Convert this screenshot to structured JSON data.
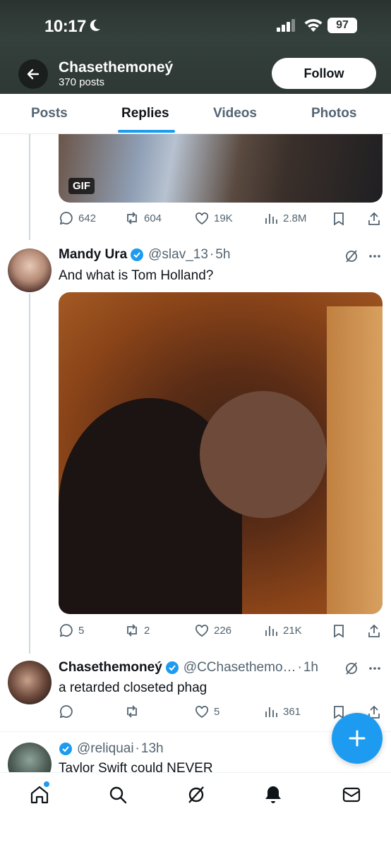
{
  "status_bar": {
    "time": "10:17",
    "battery": "97"
  },
  "header": {
    "profile_name": "Chasethemoneý",
    "post_count": "370 posts",
    "follow_label": "Follow"
  },
  "tabs": [
    {
      "label": "Posts",
      "active": false
    },
    {
      "label": "Replies",
      "active": true
    },
    {
      "label": "Videos",
      "active": false
    },
    {
      "label": "Photos",
      "active": false
    }
  ],
  "tweets": [
    {
      "media_badge": "GIF",
      "stats": {
        "replies": "642",
        "reposts": "604",
        "likes": "19K",
        "views": "2.8M"
      }
    },
    {
      "name": "Mandy Ura",
      "verified": true,
      "handle": "@slav_13",
      "time": "5h",
      "text": "And what is Tom Holland?",
      "stats": {
        "replies": "5",
        "reposts": "2",
        "likes": "226",
        "views": "21K"
      }
    },
    {
      "name": "Chasethemoneý",
      "verified": true,
      "handle": "@CChasethemo…",
      "time": "1h",
      "text": "a retarded closeted phag",
      "stats": {
        "replies": "",
        "reposts": "",
        "likes": "5",
        "views": "361"
      }
    },
    {
      "name": "",
      "verified": true,
      "handle": "@reliquai",
      "time": "13h",
      "text": "Taylor Swift could NEVER"
    }
  ],
  "colors": {
    "accent": "#1d9bf0",
    "text_primary": "#0f1419",
    "text_secondary": "#536471",
    "banner": "#2e3835"
  },
  "icons": {
    "nav": [
      "home-icon",
      "search-icon",
      "grok-icon",
      "notifications-icon",
      "messages-icon"
    ],
    "fab": "plus-icon"
  }
}
